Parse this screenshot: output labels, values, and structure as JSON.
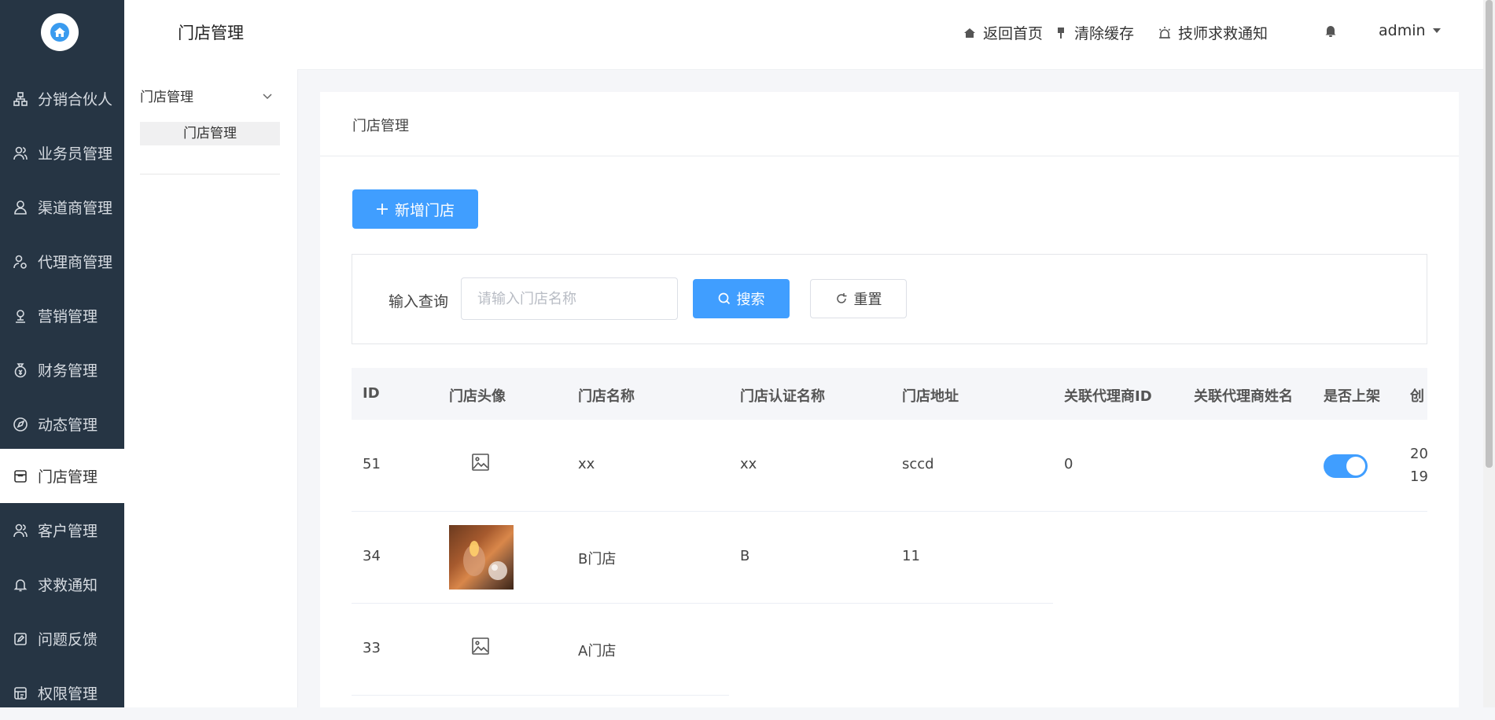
{
  "sidebar": {
    "items": [
      {
        "label": "分销合伙人",
        "icon": "partners-icon"
      },
      {
        "label": "业务员管理",
        "icon": "salesperson-icon"
      },
      {
        "label": "渠道商管理",
        "icon": "channel-icon"
      },
      {
        "label": "代理商管理",
        "icon": "agent-icon"
      },
      {
        "label": "营销管理",
        "icon": "marketing-icon"
      },
      {
        "label": "财务管理",
        "icon": "finance-icon"
      },
      {
        "label": "动态管理",
        "icon": "compass-icon"
      },
      {
        "label": "门店管理",
        "icon": "store-icon",
        "active": true
      },
      {
        "label": "客户管理",
        "icon": "customers-icon"
      },
      {
        "label": "求救通知",
        "icon": "bell-icon"
      },
      {
        "label": "问题反馈",
        "icon": "feedback-icon"
      },
      {
        "label": "权限管理",
        "icon": "permission-icon"
      }
    ]
  },
  "submenu": {
    "title": "门店管理",
    "group": "门店管理",
    "leaf": "门店管理"
  },
  "header": {
    "home": "返回首页",
    "clear_cache": "清除缓存",
    "sos_notice": "技师求救通知",
    "user": "admin"
  },
  "card": {
    "title": "门店管理",
    "add_button": "新增门店",
    "filter": {
      "label": "输入查询",
      "placeholder": "请输入门店名称",
      "value": "",
      "search_button": "搜索",
      "reset_button": "重置"
    }
  },
  "table": {
    "columns": [
      "ID",
      "门店头像",
      "门店名称",
      "门店认证名称",
      "门店地址",
      "关联代理商ID",
      "关联代理商姓名",
      "是否上架",
      "创"
    ],
    "rows": [
      {
        "id": "51",
        "avatar": "placeholder",
        "name": "xx",
        "cert_name": "xx",
        "address": "sccd",
        "agent_id": "0",
        "agent_name": "",
        "listed": true,
        "created": "20",
        "created2": "19"
      },
      {
        "id": "34",
        "avatar": "photo",
        "name": "B门店",
        "cert_name": "B",
        "address": "11"
      },
      {
        "id": "33",
        "avatar": "placeholder",
        "name": "A门店"
      }
    ]
  },
  "colors": {
    "sidebar_bg": "#263544",
    "primary": "#409eff"
  }
}
